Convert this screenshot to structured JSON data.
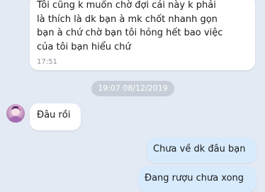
{
  "conversation": {
    "messages": [
      {
        "direction": "incoming",
        "text": "Tôi cũng k muốn chờ đợi cái này k phải\nlà thích là dk bạn à mk chốt nhanh gọn\nbạn à chứ chờ bạn tôi hỏng hết bao việc\ncủa tôi bạn hiểu chứ",
        "time": "17:51"
      },
      {
        "direction": "incoming",
        "text": "Đâu rồi"
      },
      {
        "direction": "outgoing",
        "text": "Chưa về dk đâu bạn"
      },
      {
        "direction": "outgoing",
        "text": "Đang rượu chưa xong"
      }
    ],
    "date_separator": "19:07 08/12/2019"
  },
  "colors": {
    "background": "#e3eaf4",
    "incoming_bubble": "#ffffff",
    "outgoing_bubble": "#d8ebfd",
    "date_pill": "#c8ced7"
  }
}
